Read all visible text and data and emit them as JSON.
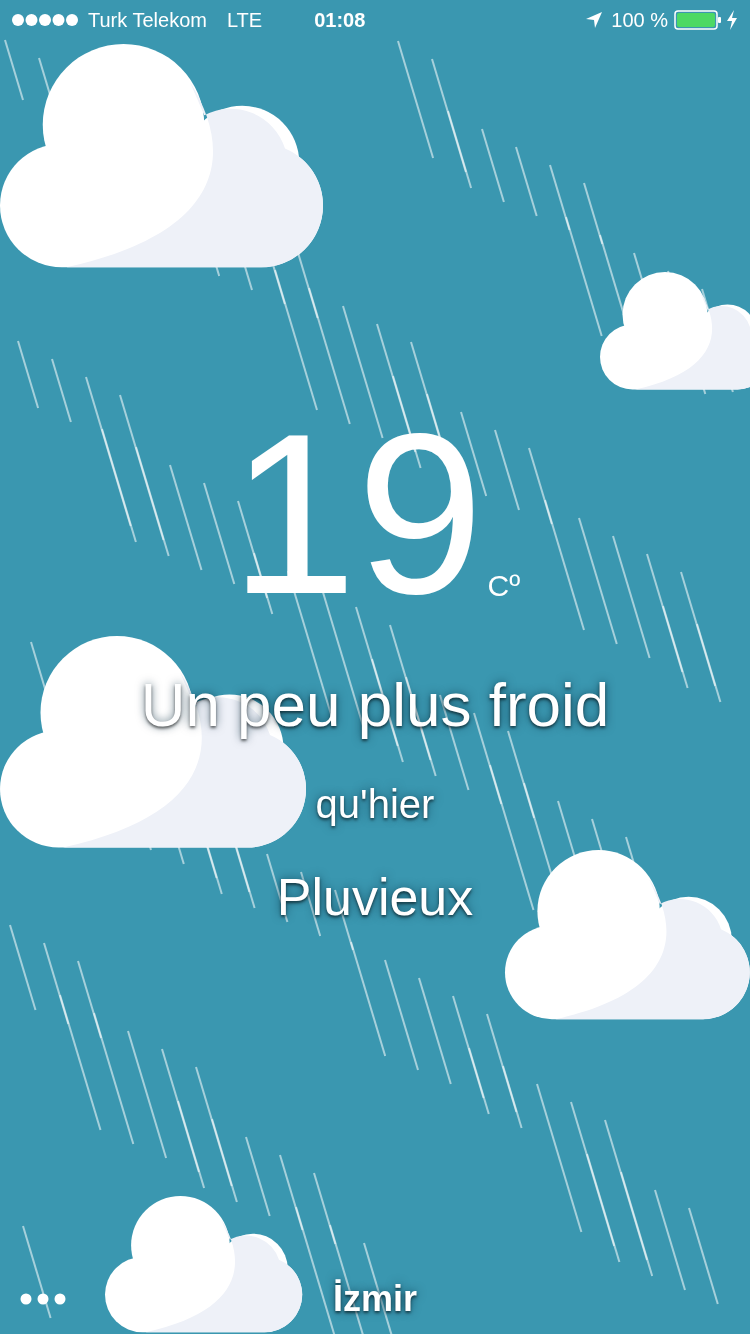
{
  "status_bar": {
    "carrier": "Turk Telekom",
    "network": "LTE",
    "time": "01:08",
    "battery": "100 %"
  },
  "temperature": {
    "value": "19",
    "unit": "Cº"
  },
  "comparison": [
    "Un peu plus froid",
    "qu'hier"
  ],
  "condition": "Pluvieux",
  "footer": {
    "city": "İzmir"
  }
}
